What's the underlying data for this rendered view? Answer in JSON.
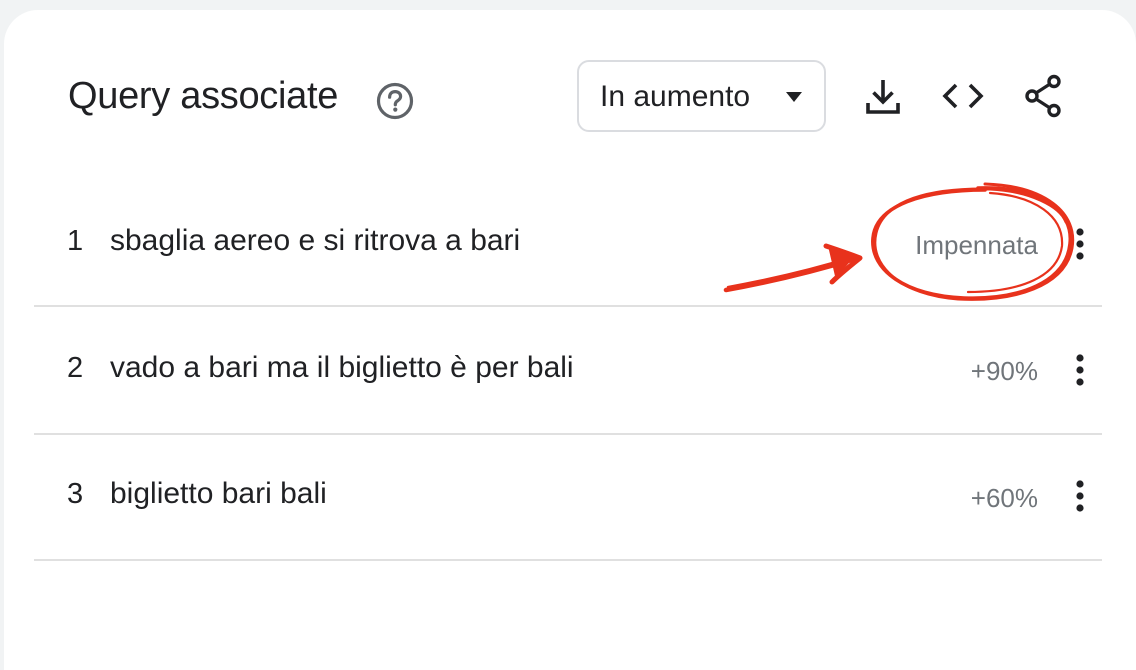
{
  "header": {
    "title": "Query associate",
    "help_icon": "help-circle-icon",
    "dropdown": {
      "selected": "In aumento"
    },
    "tools": [
      {
        "name": "download-icon"
      },
      {
        "name": "embed-code-icon"
      },
      {
        "name": "share-icon"
      }
    ]
  },
  "rows": [
    {
      "rank": "1",
      "query": "sbaglia aereo e si ritrova a bari",
      "value": "Impennata"
    },
    {
      "rank": "2",
      "query": "vado a bari ma il biglietto è per bali",
      "value": "+90%"
    },
    {
      "rank": "3",
      "query": "biglietto bari bali",
      "value": "+60%"
    }
  ],
  "colors": {
    "background": "#f1f3f4",
    "card": "#ffffff",
    "text": "#202124",
    "secondary_text": "#70757a",
    "annotation": "#e8321c"
  }
}
